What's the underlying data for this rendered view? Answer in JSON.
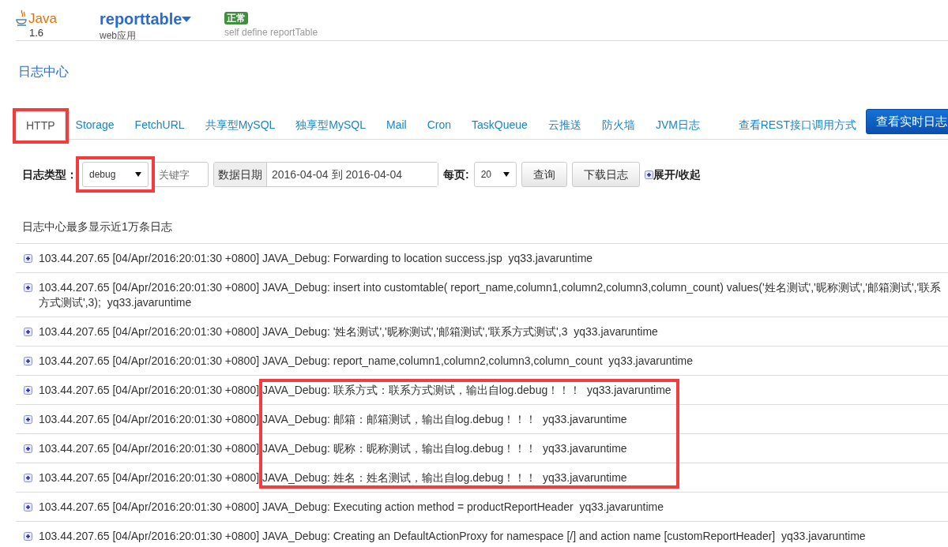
{
  "header": {
    "logo_text": "Java",
    "version": "1.6",
    "app_name": "reporttable",
    "app_type": "web应用",
    "status_badge": "正常",
    "description": "self define reportTable"
  },
  "section_title": "日志中心",
  "tabs": [
    {
      "label": "HTTP",
      "selected": true,
      "highlighted": true
    },
    {
      "label": "Storage",
      "selected": false,
      "highlighted": false
    },
    {
      "label": "FetchURL",
      "selected": false,
      "highlighted": false
    },
    {
      "label": "共享型MySQL",
      "selected": false,
      "highlighted": false
    },
    {
      "label": "独享型MySQL",
      "selected": false,
      "highlighted": false
    },
    {
      "label": "Mail",
      "selected": false,
      "highlighted": false
    },
    {
      "label": "Cron",
      "selected": false,
      "highlighted": false
    },
    {
      "label": "TaskQueue",
      "selected": false,
      "highlighted": false
    },
    {
      "label": "云推送",
      "selected": false,
      "highlighted": false
    },
    {
      "label": "防火墙",
      "selected": false,
      "highlighted": false
    },
    {
      "label": "JVM日志",
      "selected": false,
      "highlighted": false
    }
  ],
  "rest_link": "查看REST接口调用方式",
  "realtime_button": "查看实时日志",
  "filters": {
    "log_type_label": "日志类型：",
    "log_type_value": "debug",
    "log_type_highlighted": true,
    "keyword_placeholder": "关键字",
    "date_label": "数据日期",
    "date_range": "2016-04-04 到 2016-04-04",
    "per_page_label": "每页:",
    "per_page_value": "20",
    "query_button": "查询",
    "download_button": "下载日志",
    "expand_toggle": "展开/收起"
  },
  "notice": "日志中心最多显示近1万条日志",
  "rows": [
    {
      "prefix": "103.44.207.65 [04/Apr/2016:20:01:30 +0800]",
      "message": "JAVA_Debug: Forwarding to location success.jsp  yq33.javaruntime",
      "highlighted": false
    },
    {
      "prefix": "103.44.207.65 [04/Apr/2016:20:01:30 +0800]",
      "message": "JAVA_Debug: insert into customtable( report_name,column1,column2,column3,column_count) values('姓名测试','昵称测试','邮箱测试','联系方式测试',3);  yq33.javaruntime",
      "highlighted": false
    },
    {
      "prefix": "103.44.207.65 [04/Apr/2016:20:01:30 +0800]",
      "message": "JAVA_Debug: '姓名测试','昵称测试','邮箱测试','联系方式测试',3  yq33.javaruntime",
      "highlighted": false
    },
    {
      "prefix": "103.44.207.65 [04/Apr/2016:20:01:30 +0800]",
      "message": "JAVA_Debug: report_name,column1,column2,column3,column_count  yq33.javaruntime",
      "highlighted": false
    },
    {
      "prefix": "103.44.207.65 [04/Apr/2016:20:01:30 +0800]",
      "message": "JAVA_Debug: 联系方式：联系方式测试，输出自log.debug！！！  yq33.javaruntime",
      "highlighted": true
    },
    {
      "prefix": "103.44.207.65 [04/Apr/2016:20:01:30 +0800]",
      "message": "JAVA_Debug: 邮箱：邮箱测试，输出自log.debug！！！  yq33.javaruntime",
      "highlighted": true
    },
    {
      "prefix": "103.44.207.65 [04/Apr/2016:20:01:30 +0800]",
      "message": "JAVA_Debug: 昵称：昵称测试，输出自log.debug！！！  yq33.javaruntime",
      "highlighted": true
    },
    {
      "prefix": "103.44.207.65 [04/Apr/2016:20:01:30 +0800]",
      "message": "JAVA_Debug: 姓名：姓名测试，输出自log.debug！！！  yq33.javaruntime",
      "highlighted": true
    },
    {
      "prefix": "103.44.207.65 [04/Apr/2016:20:01:30 +0800]",
      "message": "JAVA_Debug: Executing action method = productReportHeader  yq33.javaruntime",
      "highlighted": false
    },
    {
      "prefix": "103.44.207.65 [04/Apr/2016:20:01:30 +0800]",
      "message": "JAVA_Debug: Creating an DefaultActionProxy for namespace [/] and action name [customReportHeader]  yq33.javaruntime",
      "highlighted": false
    }
  ]
}
